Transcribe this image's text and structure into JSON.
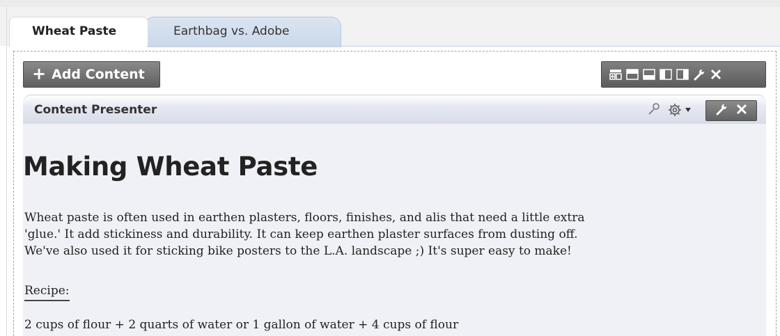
{
  "tabs": [
    {
      "label": "Wheat Paste",
      "active": true
    },
    {
      "label": "Earthbag vs. Adobe",
      "active": false
    }
  ],
  "toolbar": {
    "add_content_label": "Add Content",
    "add_content_icon": "plus-icon",
    "layout_icons": [
      "add-box-icon",
      "layout-one-column-top-icon",
      "layout-one-column-bottom-icon",
      "layout-two-column-left-icon",
      "layout-two-column-right-icon",
      "wrench-icon",
      "close-icon"
    ]
  },
  "presenter": {
    "title": "Content Presenter",
    "icons": [
      "wrench-outline-icon",
      "gear-icon",
      "chevron-down-icon",
      "wrench-icon",
      "close-icon"
    ]
  },
  "content": {
    "heading": "Making Wheat Paste",
    "paragraph_lines": [
      "Wheat paste is often used in earthen plasters, floors, finishes, and alis that need a little extra",
      "'glue.' It add stickiness and durability. It can keep earthen plaster surfaces from dusting off.",
      "We've also used it for sticking bike posters to the L.A. landscape ;) It's super easy to make!"
    ],
    "recipe_label": "Recipe:",
    "ingredients": "2 cups of flour + 2 quarts of water or 1 gallon of water + 4 cups of flour"
  },
  "colors": {
    "toolbar_dark": "#5f5f5f",
    "tab_inactive": "#c9d8ea",
    "presenter_body": "#f0f1f6"
  }
}
